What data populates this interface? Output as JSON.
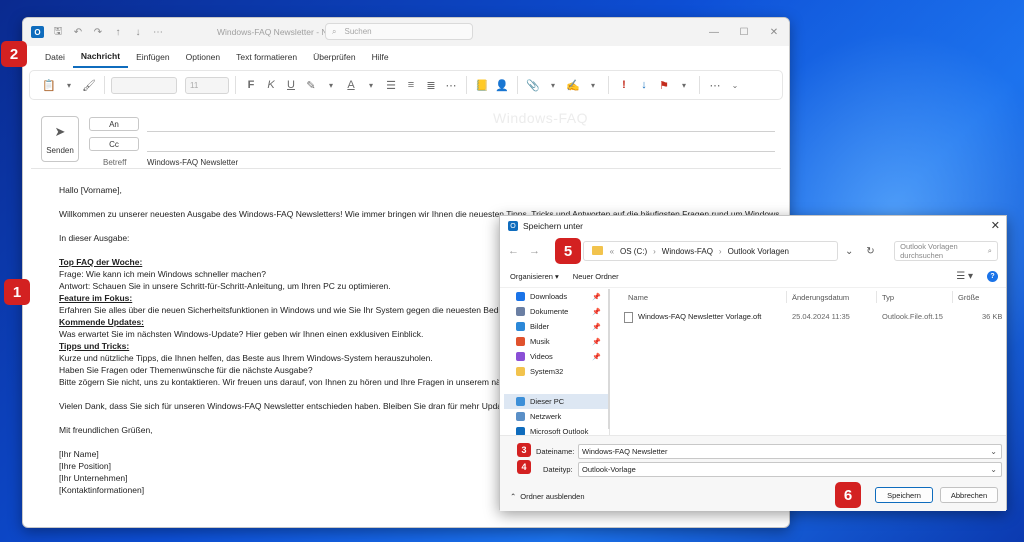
{
  "outlook": {
    "title": "Windows-FAQ Newsletter - Nachricht (HT",
    "search_placeholder": "Suchen",
    "menu": [
      "Datei",
      "Nachricht",
      "Einfügen",
      "Optionen",
      "Text formatieren",
      "Überprüfen",
      "Hilfe"
    ],
    "ribbon_font_size": "11",
    "send_label": "Senden",
    "to_label": "An",
    "cc_label": "Cc",
    "subject_label": "Betreff",
    "subject_value": "Windows-FAQ Newsletter",
    "watermark": "Windows-FAQ",
    "body": {
      "greeting": "Hallo [Vorname],",
      "intro": "Willkommen zu unserer neuesten Ausgabe des Windows-FAQ Newsletters! Wie immer bringen wir Ihnen die neuesten Tipps, Tricks und Antworten auf die häufigsten Fragen rund um Windows.",
      "in_issue": "In dieser Ausgabe:",
      "h1": "Top FAQ der Woche:",
      "l1": "Frage: Wie kann ich mein Windows schneller machen?",
      "l2": "Antwort: Schauen Sie in unsere Schritt-für-Schritt-Anleitung, um Ihren PC zu optimieren.",
      "h2": "Feature im Fokus:",
      "l3": "Erfahren Sie alles über die neuen Sicherheitsfunktionen in Windows und wie Sie Ihr System gegen die neuesten Bedrohunger",
      "h3": "Kommende Updates:",
      "l4": "Was erwartet Sie im nächsten Windows-Update? Hier geben wir Ihnen einen exklusiven Einblick.",
      "h4": "Tipps und Tricks:",
      "l5": "Kurze und nützliche Tipps, die Ihnen helfen, das Beste aus Ihrem Windows-System herauszuholen.",
      "l6": "Haben Sie Fragen oder Themenwünsche für die nächste Ausgabe?",
      "l7": "Bitte zögern Sie nicht, uns zu kontaktieren. Wir freuen uns darauf, von Ihnen zu hören und Ihre Fragen in unserem nächsten N",
      "thanks": "Vielen Dank, dass Sie sich für unseren Windows-FAQ Newsletter entschieden haben. Bleiben Sie dran für mehr Updates und",
      "regards": "Mit freundlichen Grüßen,",
      "sig1": "[Ihr Name]",
      "sig2": "[Ihre Position]",
      "sig3": "[Ihr Unternehmen]",
      "sig4": "[Kontaktinformationen]"
    }
  },
  "dialog": {
    "title": "Speichern unter",
    "path": [
      "«",
      "OS (C:)",
      "›",
      "Windows-FAQ",
      "›",
      "Outlook Vorlagen"
    ],
    "search_placeholder": "Outlook Vorlagen durchsuchen",
    "organize": "Organisieren ▾",
    "new_folder": "Neuer Ordner",
    "nav": [
      {
        "label": "Downloads",
        "color": "#1a73e8",
        "pinned": true
      },
      {
        "label": "Dokumente",
        "color": "#6b7fa3",
        "pinned": true
      },
      {
        "label": "Bilder",
        "color": "#2b88d8",
        "pinned": true
      },
      {
        "label": "Musik",
        "color": "#e0522d",
        "pinned": true
      },
      {
        "label": "Videos",
        "color": "#8a4fd6",
        "pinned": true
      },
      {
        "label": "System32",
        "color": "#f2c34d",
        "pinned": false
      },
      {
        "label": "Dieser PC",
        "color": "#3c8fd8",
        "pinned": false
      },
      {
        "label": "Netzwerk",
        "color": "#5a8fc7",
        "pinned": false
      },
      {
        "label": "Microsoft Outlook",
        "color": "#0f6cbd",
        "pinned": false
      }
    ],
    "columns": [
      "Name",
      "Änderungsdatum",
      "Typ",
      "Größe"
    ],
    "file": {
      "name": "Windows-FAQ Newsletter Vorlage.oft",
      "date": "25.04.2024 11:35",
      "type": "Outlook.File.oft.15",
      "size": "36 KB"
    },
    "filename_label": "Dateiname:",
    "filename_value": "Windows-FAQ Newsletter",
    "filetype_label": "Dateityp:",
    "filetype_value": "Outlook-Vorlage",
    "hide_folders": "Ordner ausblenden",
    "save_btn": "Speichern",
    "cancel_btn": "Abbrechen"
  },
  "badges": [
    "1",
    "2",
    "3",
    "4",
    "5",
    "6"
  ],
  "colors": {
    "accent": "#0f6cbd",
    "badge": "#d32121"
  }
}
